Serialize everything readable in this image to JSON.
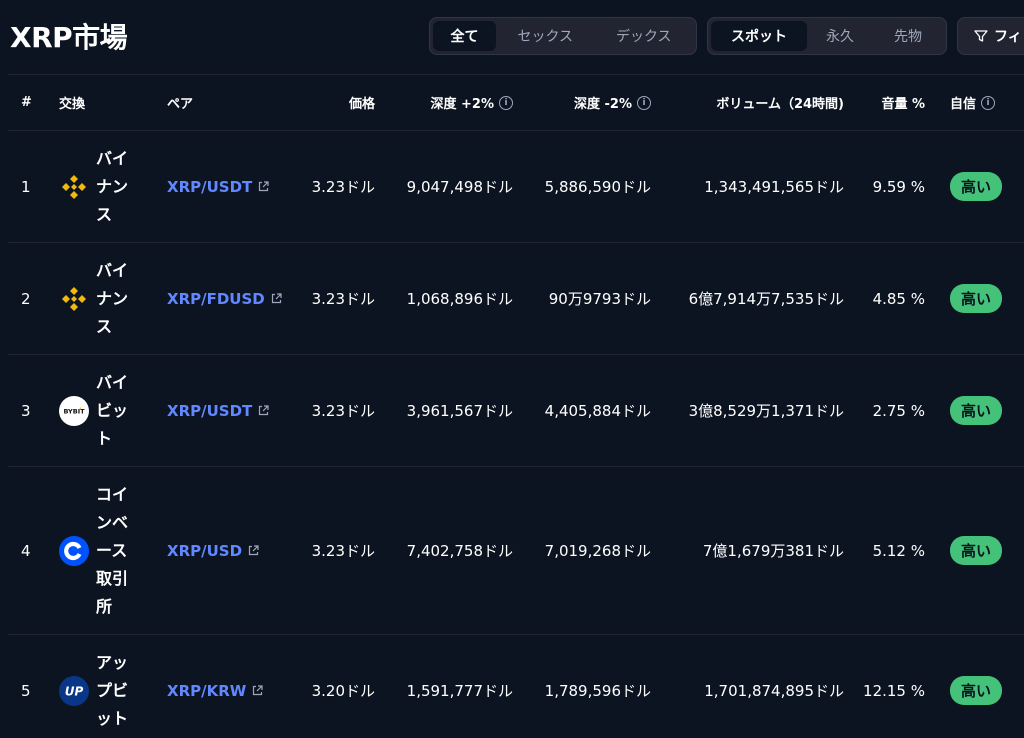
{
  "title": "XRP市場",
  "filter_group_1": [
    "全て",
    "セックス",
    "デックス"
  ],
  "filter_group_2": [
    "スポット",
    "永久",
    "先物"
  ],
  "filter_button": "フィ",
  "headers": {
    "num": "#",
    "exchange": "交換",
    "pair": "ペア",
    "price": "価格",
    "depth_plus": "深度 +2%",
    "depth_minus": "深度 -2%",
    "volume": "ボリューム（24時間)",
    "volume_share": "音量 %",
    "confidence": "自信"
  },
  "rows": [
    {
      "num": "1",
      "exchange": "バイナンス",
      "logo": "binance-logo",
      "pair": "XRP/USDT",
      "price": "3.23ドル",
      "depth_plus": "9,047,498ドル",
      "depth_minus": "5,886,590ドル",
      "volume": "1,343,491,565ドル",
      "share": "9.59 %",
      "confidence": "高い"
    },
    {
      "num": "2",
      "exchange": "バイナンス",
      "logo": "binance-logo",
      "pair": "XRP/FDUSD",
      "price": "3.23ドル",
      "depth_plus": "1,068,896ドル",
      "depth_minus": "90万9793ドル",
      "volume": "6億7,914万7,535ドル",
      "share": "4.85 %",
      "confidence": "高い"
    },
    {
      "num": "3",
      "exchange": "バイビット",
      "logo": "bybit-logo",
      "pair": "XRP/USDT",
      "price": "3.23ドル",
      "depth_plus": "3,961,567ドル",
      "depth_minus": "4,405,884ドル",
      "volume": "3億8,529万1,371ドル",
      "share": "2.75 %",
      "confidence": "高い"
    },
    {
      "num": "4",
      "exchange": "コインベース取引所",
      "logo": "coinbase-logo",
      "pair": "XRP/USD",
      "price": "3.23ドル",
      "depth_plus": "7,402,758ドル",
      "depth_minus": "7,019,268ドル",
      "volume": "7億1,679万381ドル",
      "share": "5.12 %",
      "confidence": "高い"
    },
    {
      "num": "5",
      "exchange": "アップビット",
      "logo": "upbit-logo",
      "pair": "XRP/KRW",
      "price": "3.20ドル",
      "depth_plus": "1,591,777ドル",
      "depth_minus": "1,789,596ドル",
      "volume": "1,701,874,895ドル",
      "share": "12.15 %",
      "confidence": "高い"
    }
  ],
  "colors": {
    "background": "#0d1421",
    "link": "#6188ff",
    "badge": "#45c27a",
    "binance": "#f0b90b",
    "coinbase": "#0052ff",
    "upbit": "#093687"
  }
}
